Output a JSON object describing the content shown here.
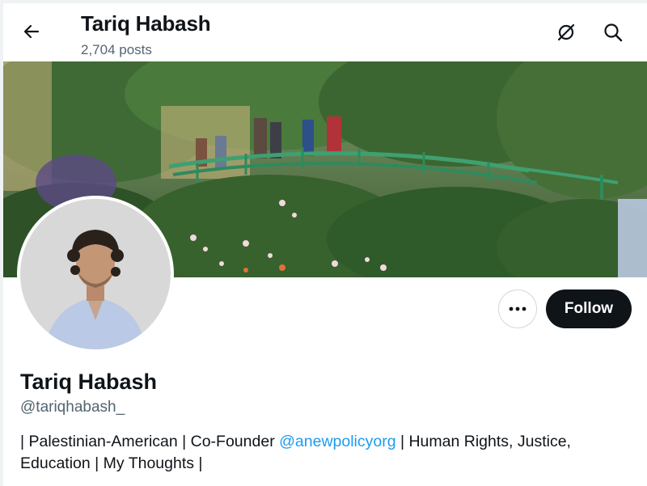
{
  "header": {
    "title": "Tariq Habash",
    "posts": "2,704 posts",
    "back_icon": "arrow-left-icon",
    "grok_icon": "grok-icon",
    "search_icon": "search-icon"
  },
  "profile": {
    "display_name": "Tariq Habash",
    "handle": "@tariqhabash_",
    "bio_before": "| Palestinian-American | Co-Founder ",
    "bio_mention": "@anewpolicyorg",
    "bio_after": " | Human Rights, Justice, Education | My Thoughts |"
  },
  "actions": {
    "more_icon": "more-dots-icon",
    "follow_label": "Follow"
  },
  "colors": {
    "accent": "#1d9bf0",
    "follow_bg": "#0f1419",
    "secondary_text": "#536471"
  }
}
